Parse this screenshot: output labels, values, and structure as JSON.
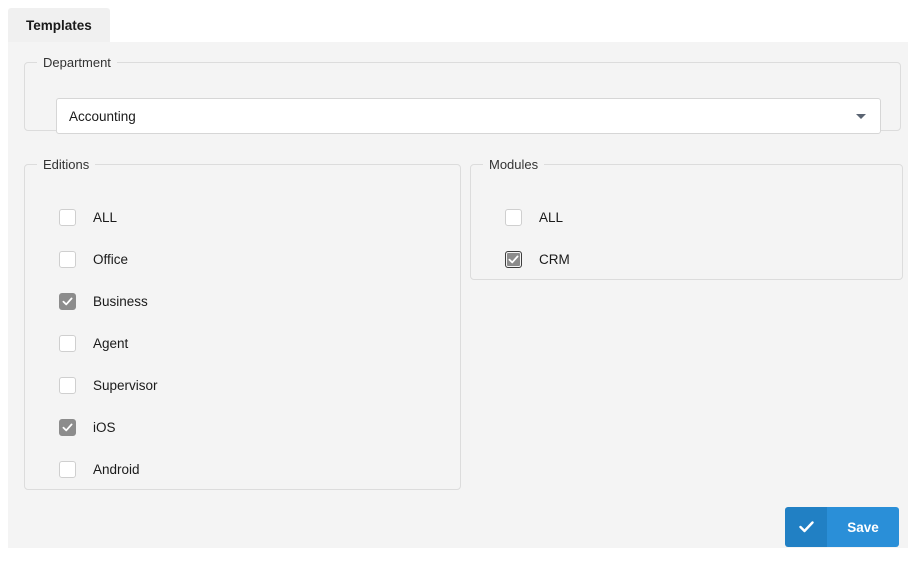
{
  "tab": {
    "label": "Templates"
  },
  "department": {
    "legend": "Department",
    "selected": "Accounting",
    "caret_icon": "chevron-down-icon"
  },
  "editions": {
    "legend": "Editions",
    "items": [
      {
        "label": "ALL",
        "checked": false,
        "focused": false
      },
      {
        "label": "Office",
        "checked": false,
        "focused": false
      },
      {
        "label": "Business",
        "checked": true,
        "focused": false
      },
      {
        "label": "Agent",
        "checked": false,
        "focused": false
      },
      {
        "label": "Supervisor",
        "checked": false,
        "focused": false
      },
      {
        "label": "iOS",
        "checked": true,
        "focused": false
      },
      {
        "label": "Android",
        "checked": false,
        "focused": false
      }
    ]
  },
  "modules": {
    "legend": "Modules",
    "items": [
      {
        "label": "ALL",
        "checked": false,
        "focused": false
      },
      {
        "label": "CRM",
        "checked": true,
        "focused": true
      }
    ]
  },
  "save": {
    "label": "Save",
    "icon": "check-icon",
    "icon_bg": "#2180c4",
    "label_bg": "#2a8fd8"
  },
  "colors": {
    "page_bg": "#ffffff",
    "panel_bg": "#f4f4f4",
    "tab_bg": "#f0f0f0",
    "group_border": "#dcdcdc",
    "checkbox_checked": "#8c8c8c",
    "accent": "#2a8fd8"
  }
}
